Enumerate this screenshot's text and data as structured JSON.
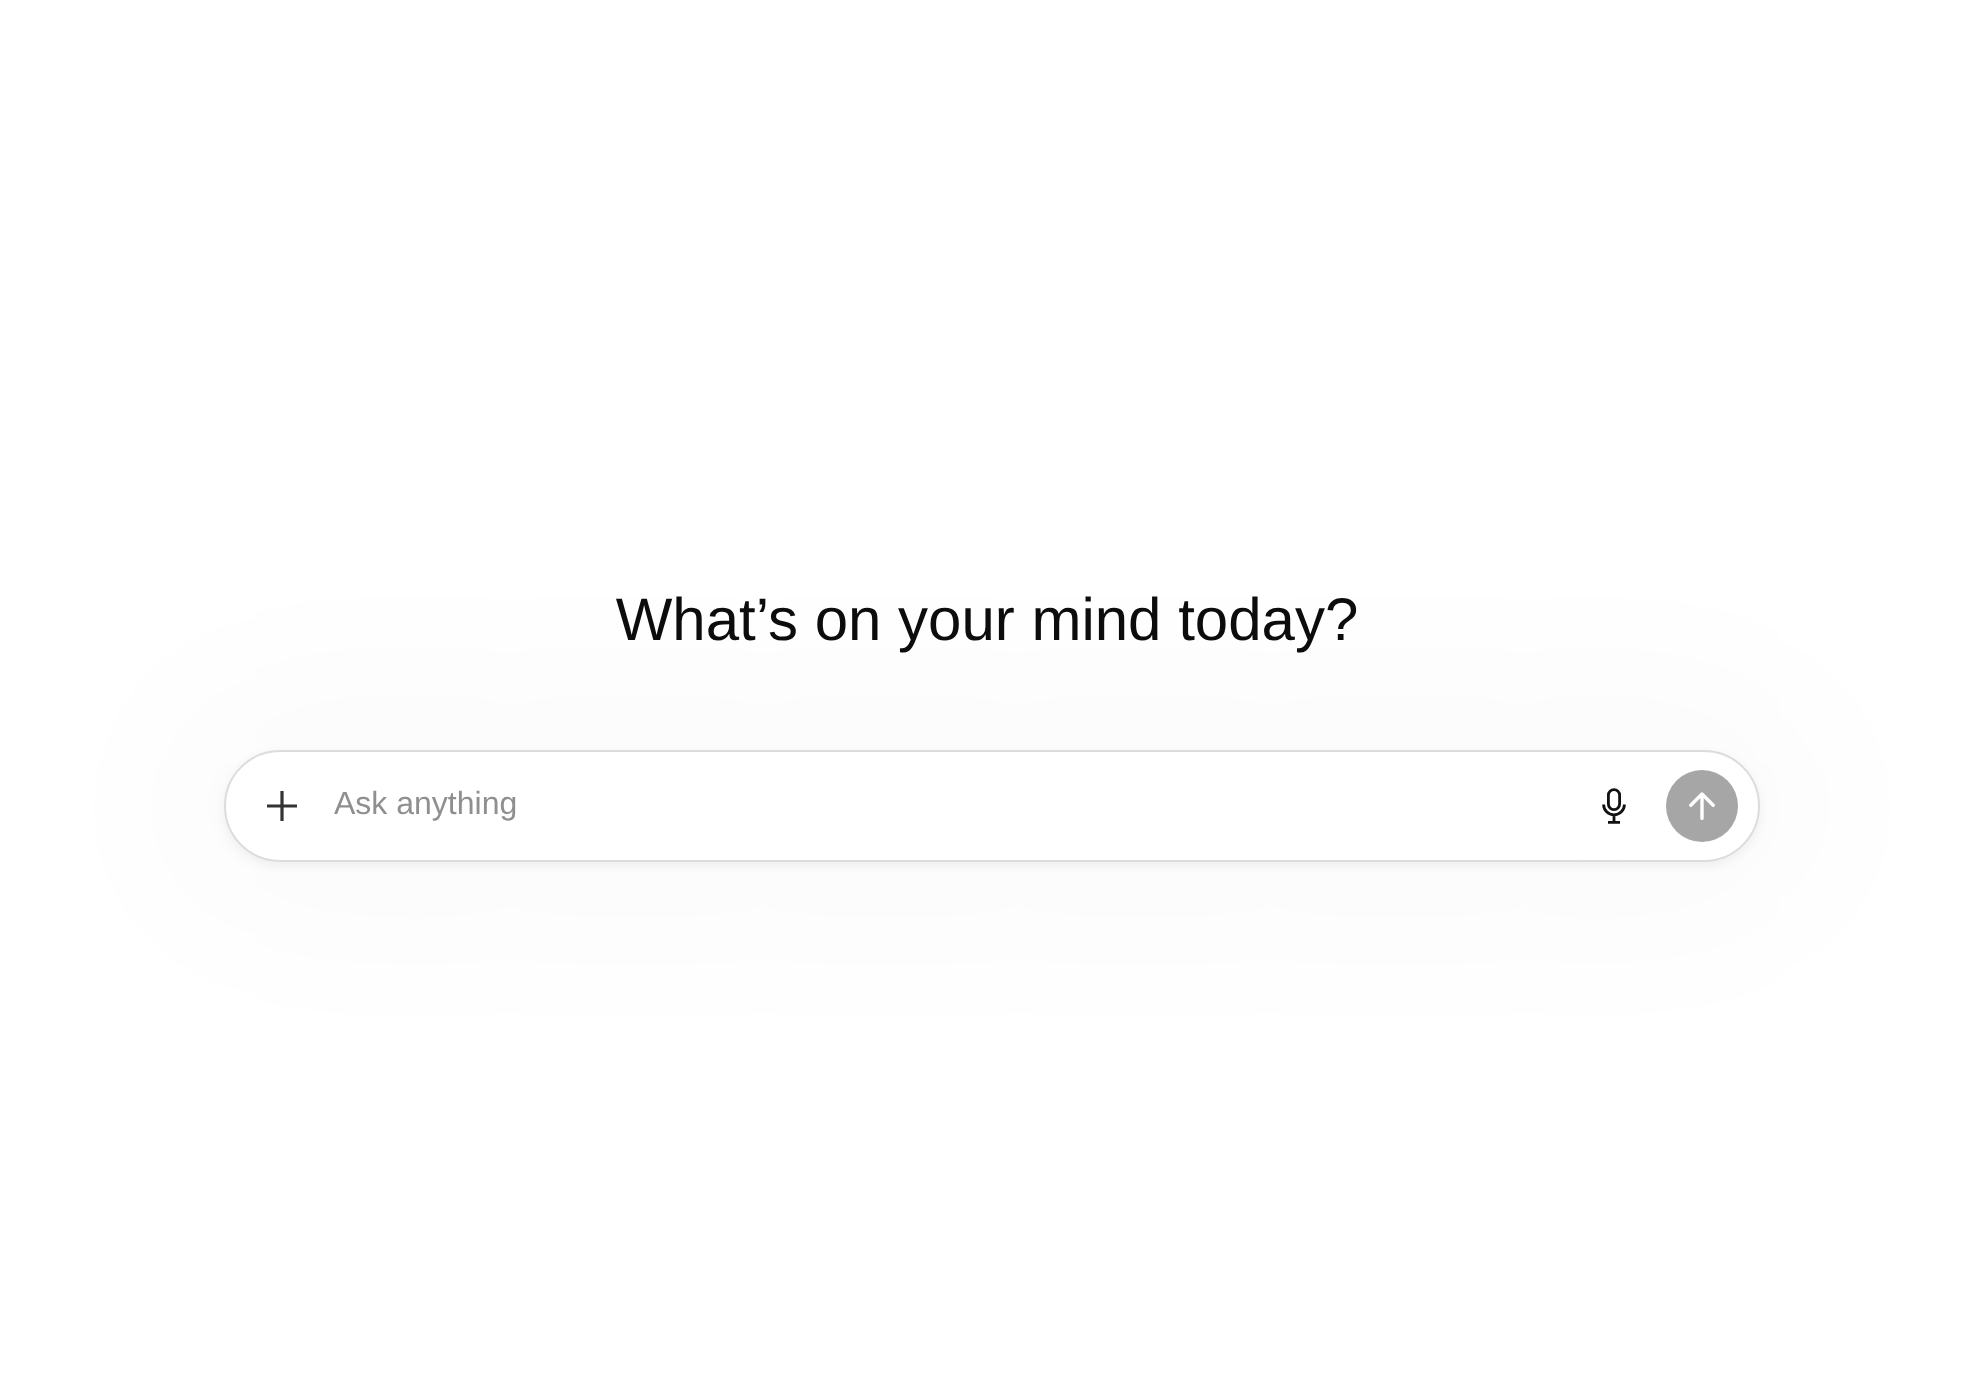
{
  "heading": "What’s on your mind today?",
  "composer": {
    "placeholder": "Ask anything",
    "send_button": {
      "disabled": true
    }
  }
}
